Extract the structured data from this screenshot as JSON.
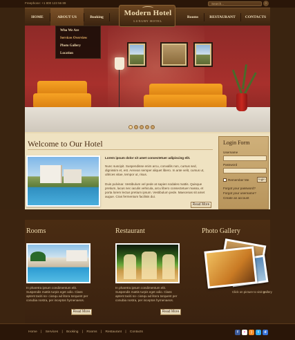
{
  "topbar": {
    "freephone": "Freephone: +1 800 123 56 89",
    "search_placeholder": "Search...",
    "search_button": "›"
  },
  "nav": {
    "items": [
      {
        "label": "HOME"
      },
      {
        "label": "ABOUT US"
      },
      {
        "label": "Booking"
      },
      {
        "label": "Rooms"
      },
      {
        "label": "RESTAURANT"
      },
      {
        "label": "CONTACTS"
      }
    ],
    "dropdown": [
      {
        "label": "Who We Are"
      },
      {
        "label": "Services Overview"
      },
      {
        "label": "Photo Gallery"
      },
      {
        "label": "Location"
      }
    ]
  },
  "logo": {
    "title": "Modern Hotel",
    "subtitle": "LUXURY HOTEL"
  },
  "hero": {
    "slides": 5,
    "active_slide": 1
  },
  "welcome": {
    "title": "Welcome to Our Hotel",
    "lead": "Lorem ipsum dolor sit amet consectetuer adipiscing elit.",
    "p1": "Nunc suscipit. Suspendisse enim arcu, convallis non, cursus sed, dignissim et, est. Aenean semper aliquet libero. In ante velit, cursus ut, ultrices vitae, tempor ut, risus.",
    "p2": "Duis pulvinar. Vestibulum vel pede at sapien sodales mattis. Quisque pretium, lacus nec iaculis vehicula, arcu libero consectetuer massa, et porta lorem lectus pretium ipsum. Vestibulum pede. Maecenas sit amet augue. Cras fermentum facilisis dui.",
    "more": "Read More"
  },
  "login": {
    "title": "Login Form",
    "username_label": "Username",
    "password_label": "Password",
    "remember": "Remember Me",
    "login_button": "login",
    "forgot_password": "Forgot your password?",
    "forgot_username": "Forgot your username?",
    "create_account": "Create an account"
  },
  "rooms": {
    "title": "Rooms",
    "text": "In pharetra ipsum condimentum elit. Suspendis mattis turpis eget odio. Class aptent taciti so- ciosqu ad litora torquent per conubia nostra, per inceptos hymenaeos.",
    "more": "Read More"
  },
  "restaurant": {
    "title": "Restaurant",
    "text": "In pharetra ipsum condimentum elit. Suspendis mattis turpis eget odio. Class aptent taciti so- ciosqu ad litora torquent per conubia nostra, per inceptos hymenaeos.",
    "more": "Read More"
  },
  "gallery": {
    "title": "Photo Gallery",
    "caption": "Click on picture to visit gallery",
    "arrow": "»"
  },
  "footer": {
    "links": [
      "Home",
      "Services",
      "Booking",
      "Rooms",
      "Restaurant",
      "Contacts"
    ],
    "separator": "|",
    "social": [
      "facebook-icon",
      "flickr-icon",
      "rss-icon",
      "twitter-icon",
      "delicious-icon"
    ]
  }
}
